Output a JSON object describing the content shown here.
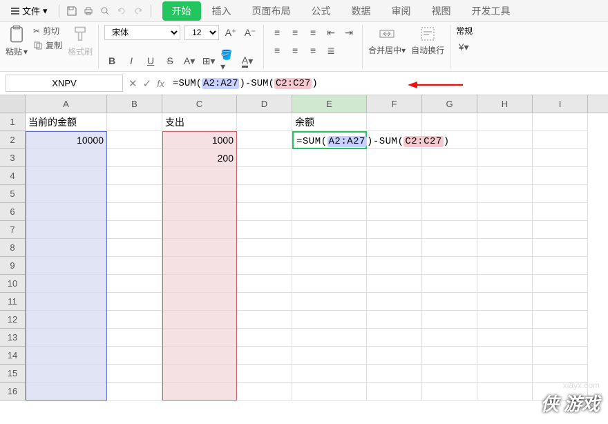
{
  "menu": {
    "file": "文件",
    "tabs": [
      "开始",
      "插入",
      "页面布局",
      "公式",
      "数据",
      "审阅",
      "视图",
      "开发工具"
    ],
    "active_tab": 0
  },
  "ribbon": {
    "paste": "粘贴",
    "cut": "剪切",
    "copy": "复制",
    "format_painter": "格式刷",
    "font_name": "宋体",
    "font_size": "12",
    "merge": "合并居中",
    "wrap": "自动换行",
    "num_format": "常规"
  },
  "formula_bar": {
    "name_box": "XNPV",
    "formula": "=SUM(A2:A27)-SUM(C2:C27)",
    "formula_prefix": "=SUM(",
    "ref1": "A2:A27",
    "mid": ")-SUM(",
    "ref2": "C2:C27",
    "suffix": ")"
  },
  "columns": [
    "A",
    "B",
    "C",
    "D",
    "E",
    "F",
    "G",
    "H",
    "I"
  ],
  "active_col": "E",
  "rows": [
    1,
    2,
    3,
    4,
    5,
    6,
    7,
    8,
    9,
    10,
    11,
    12,
    13,
    14,
    15,
    16
  ],
  "headers": {
    "A1": "当前的金额",
    "C1": "支出",
    "E1": "余额"
  },
  "data": {
    "A2": "10000",
    "C2": "1000",
    "C3": "200"
  },
  "edit_cell": {
    "prefix": "=SUM(",
    "ref1": "A2:A27",
    "mid": ")-SUM(",
    "ref2": "C2:C27",
    "suffix": ")"
  },
  "watermark": {
    "site": "xiayx.com",
    "text": "游戏"
  }
}
